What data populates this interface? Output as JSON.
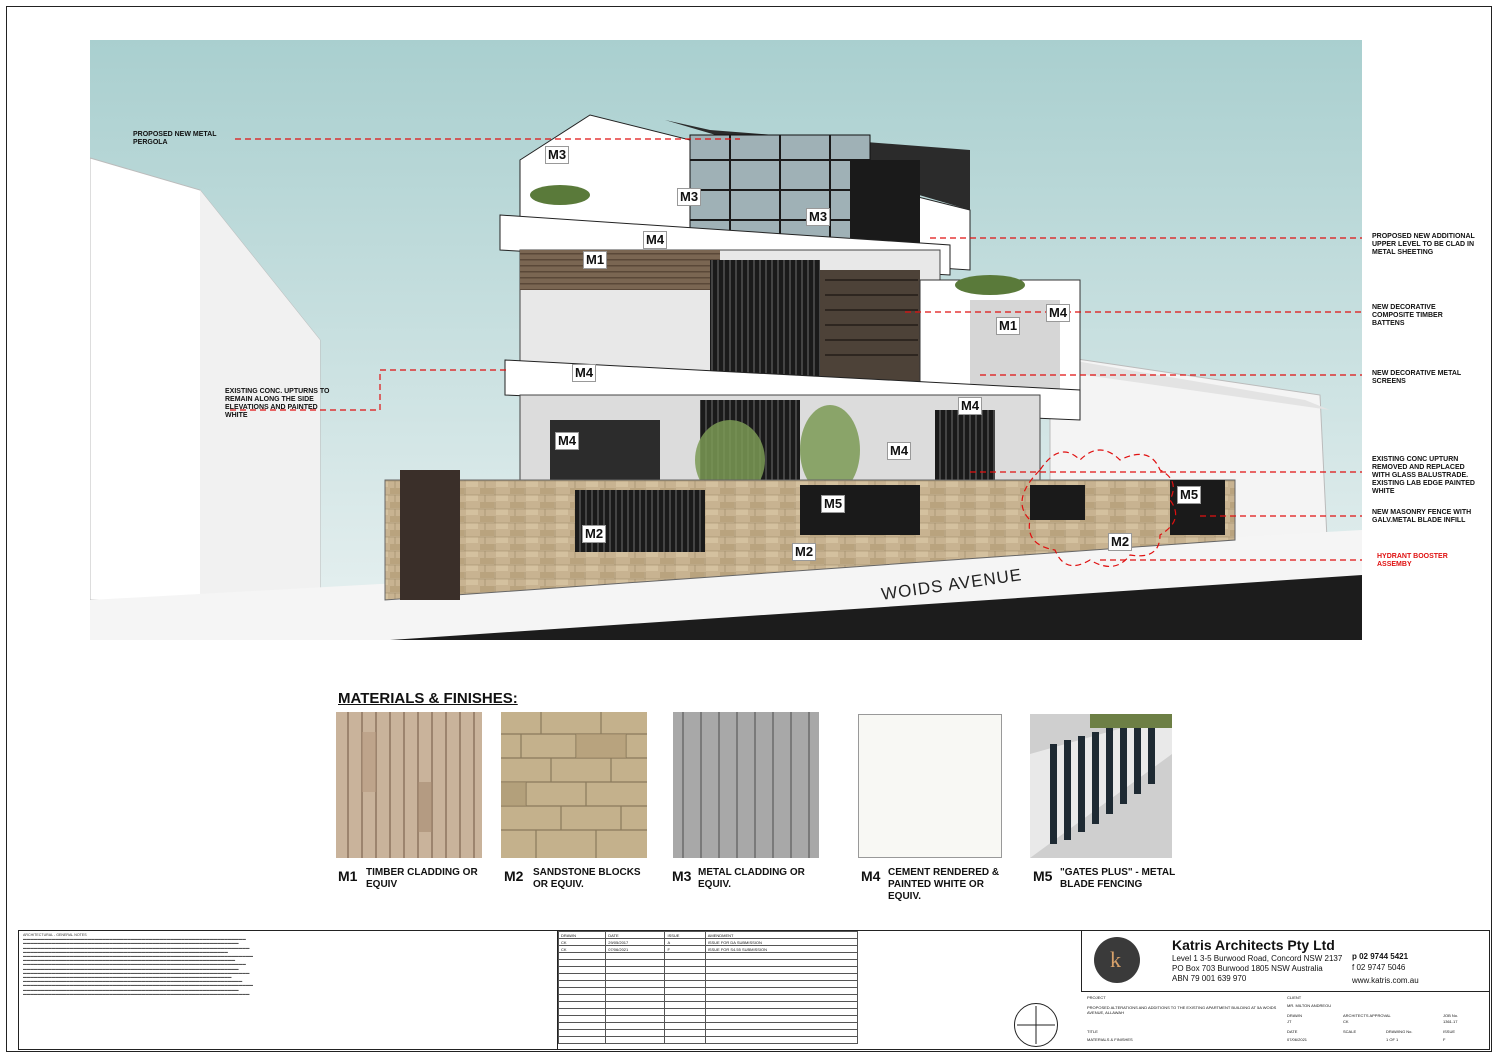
{
  "tags": {
    "m3a": "M3",
    "m3b": "M3",
    "m3c": "M3",
    "m4a": "M4",
    "m1a": "M1",
    "m4b": "M4",
    "m1b": "M1",
    "m4c": "M4",
    "m4d": "M4",
    "m4e": "M4",
    "m4f": "M4",
    "m5a": "M5",
    "m5b": "M5",
    "m2a": "M2",
    "m2b": "M2",
    "m2c": "M2"
  },
  "callouts": {
    "pergola": "PROPOSED NEW METAL PERGOLA",
    "upturns": "EXISTING CONC. UPTURNS TO REMAIN ALONG THE SIDE ELEVATIONS AND PAINTED WHITE",
    "upper_level": "PROPOSED NEW ADDITIONAL UPPER LEVEL TO BE CLAD IN METAL SHEETING",
    "battens": "NEW DECORATIVE COMPOSITE TIMBER BATTENS",
    "screens": "NEW DECORATIVE METAL SCREENS",
    "upturn_removed": "EXISTING CONC UPTURN REMOVED AND REPLACED WITH GLASS BALUSTRADE. EXISTING LAB EDGE PAINTED WHITE",
    "fence": "NEW MASONRY FENCE WITH GALV.METAL BLADE INFILL",
    "hydrant": "HYDRANT BOOSTER ASSEMBY"
  },
  "street": "WOIDS AVENUE",
  "materials_title": "MATERIALS & FINISHES:",
  "materials": [
    {
      "code": "M1",
      "label": "TIMBER CLADDING OR EQUIV"
    },
    {
      "code": "M2",
      "label": "SANDSTONE BLOCKS OR EQUIV."
    },
    {
      "code": "M3",
      "label": "METAL CLADDING OR EQUIV."
    },
    {
      "code": "M4",
      "label": "CEMENT RENDERED & PAINTED WHITE OR EQUIV."
    },
    {
      "code": "M5",
      "label": "\"GATES PLUS\" - METAL BLADE FENCING"
    }
  ],
  "title_block": {
    "notes_heading": "ARCHITECTURAL - GENERAL NOTES",
    "revisions": [
      {
        "drawn": "CK",
        "date": "29/05/2017",
        "issue": "A",
        "amendment": "ISSUE FOR DA SUBMISSION"
      },
      {
        "drawn": "CK",
        "date": "07/06/2021",
        "issue": "F",
        "amendment": "ISSUE FOR S4.55 SUBMISSION"
      }
    ],
    "rev_headers": [
      "DRAWN",
      "DATE",
      "ISSUE",
      "AMENDMENT"
    ],
    "firm_name": "Katris Architects Pty Ltd",
    "address1": "Level 1 3-5 Burwood Road, Concord NSW 2137",
    "address2": "PO Box 703 Burwood 1805 NSW Australia",
    "abn": "ABN 79 001 639 970",
    "phone": "p 02 9744 5421",
    "fax": "f 02 9747 5046",
    "web": "www.katris.com.au",
    "logo_letter": "k",
    "project_label": "PROJECT",
    "project": "PROPOSED ALTERATIONS AND ADDITIONS TO THE EXISTING APARTMENT BUILDING AT 5A WOIDS AVENUE, ALLAWAH",
    "client_label": "CLIENT",
    "client": "MR. MILTON ANDREOU",
    "drawn_label": "DRAWN",
    "drawn": "JT",
    "approval_label": "ARCHITECTS APPROVAL",
    "approval": "CK",
    "job_label": "JOB No.",
    "job": "1361.17",
    "title_label": "TITLE",
    "title": "MATERIALS & FINISHES",
    "date_label": "DATE",
    "date": "07/06/2021",
    "scale_label": "SCALE",
    "drawing_label": "DRAWING No.",
    "drawing": "1 OF 1",
    "issue_label": "ISSUE",
    "issue": "F"
  }
}
